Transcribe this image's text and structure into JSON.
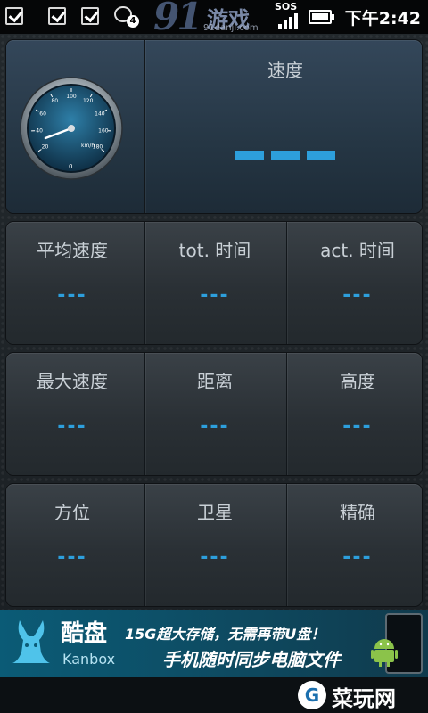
{
  "status_bar": {
    "notifications": [
      "checkbox-icon",
      "checkbox-icon",
      "checkbox-icon",
      "chat-icon"
    ],
    "chat_badge": "4",
    "watermark_num": "91",
    "watermark_cn": "游戏",
    "watermark_url": "91danji.com",
    "sos": "SOS",
    "time": "下午2:42"
  },
  "speed_panel": {
    "label": "速度",
    "gauge_ticks": [
      "20",
      "40",
      "60",
      "80",
      "100",
      "120",
      "140",
      "160",
      "180"
    ],
    "gauge_unit": "km/h",
    "gauge_zero": "0"
  },
  "grid": [
    [
      {
        "label": "平均速度",
        "value": "---"
      },
      {
        "label": "tot. 时间",
        "value": "---"
      },
      {
        "label": "act. 时间",
        "value": "---"
      }
    ],
    [
      {
        "label": "最大速度",
        "value": "---"
      },
      {
        "label": "距离",
        "value": "---"
      },
      {
        "label": "高度",
        "value": "---"
      }
    ],
    [
      {
        "label": "方位",
        "value": "---"
      },
      {
        "label": "卫星",
        "value": "---"
      },
      {
        "label": "精确",
        "value": "---"
      }
    ]
  ],
  "ad": {
    "brand_cn": "酷盘",
    "brand_en": "Kanbox",
    "line1": "15G超大存储，无需再带U盘！",
    "line2": "手机随时同步电脑文件"
  },
  "bottom_watermark": "菜玩网",
  "colors": {
    "accent": "#2d9fdc",
    "panel": "#2a3035",
    "label": "#c9d0d6"
  }
}
